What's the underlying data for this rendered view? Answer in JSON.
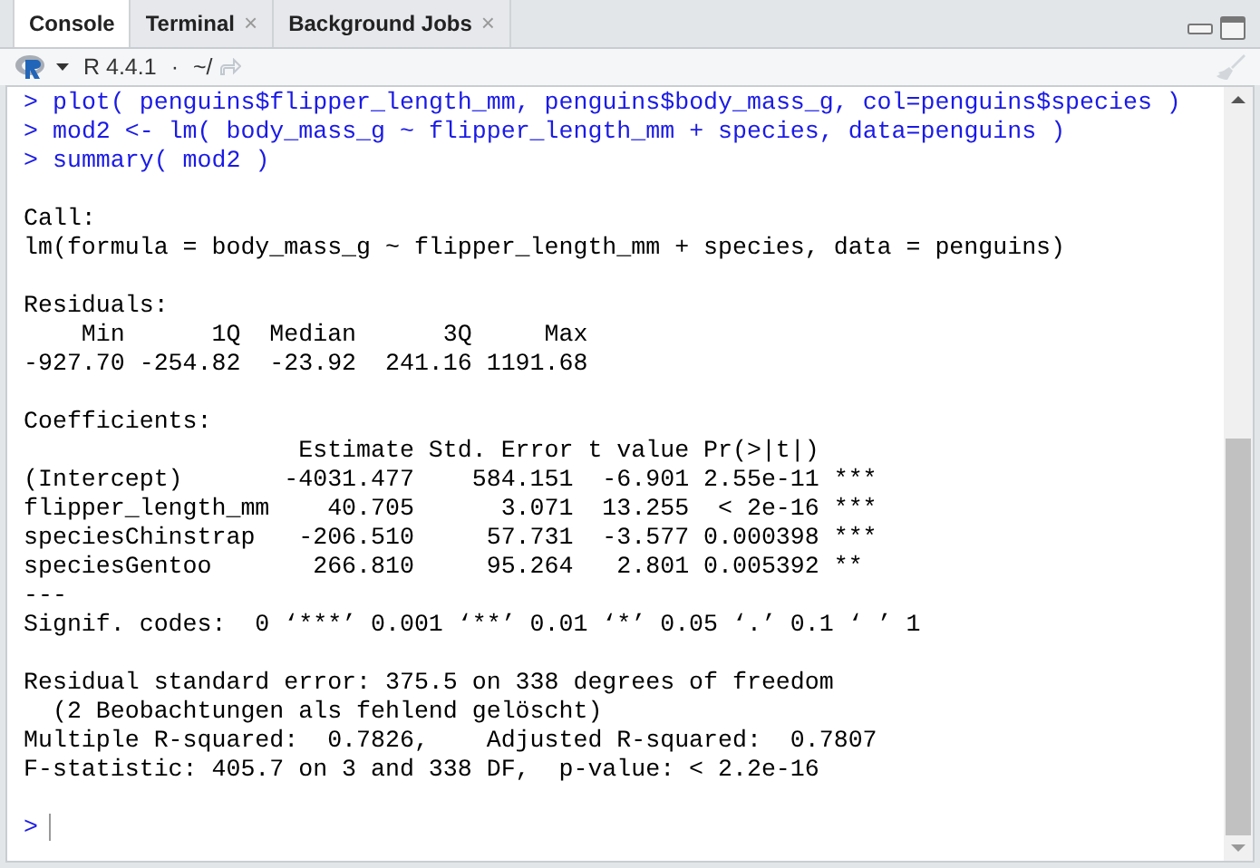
{
  "tabs": [
    {
      "label": "Console",
      "selected": true
    },
    {
      "label": "Terminal",
      "selected": false,
      "close": "×"
    },
    {
      "label": "Background Jobs",
      "selected": false,
      "close": "×"
    }
  ],
  "toolbar": {
    "version": "R 4.4.1",
    "separator": "·",
    "path": "~/"
  },
  "console": {
    "lines": [
      {
        "kind": "command",
        "prompt": ">",
        "text": "plot( penguins$flipper_length_mm, penguins$body_mass_g, col=penguins$species )"
      },
      {
        "kind": "command",
        "prompt": ">",
        "text": "mod2 <- lm( body_mass_g ~ flipper_length_mm + species, data=penguins )"
      },
      {
        "kind": "command",
        "prompt": ">",
        "text": "summary( mod2 )"
      },
      {
        "kind": "blank"
      },
      {
        "kind": "output",
        "text": "Call:"
      },
      {
        "kind": "output",
        "text": "lm(formula = body_mass_g ~ flipper_length_mm + species, data = penguins)"
      },
      {
        "kind": "blank"
      },
      {
        "kind": "output",
        "text": "Residuals:"
      },
      {
        "kind": "output",
        "text": "    Min      1Q  Median      3Q     Max"
      },
      {
        "kind": "output",
        "text": "-927.70 -254.82  -23.92  241.16 1191.68"
      },
      {
        "kind": "blank"
      },
      {
        "kind": "output",
        "text": "Coefficients:"
      },
      {
        "kind": "output",
        "text": "                   Estimate Std. Error t value Pr(>|t|)"
      },
      {
        "kind": "output",
        "text": "(Intercept)       -4031.477    584.151  -6.901 2.55e-11 ***"
      },
      {
        "kind": "output",
        "text": "flipper_length_mm    40.705      3.071  13.255  < 2e-16 ***"
      },
      {
        "kind": "output",
        "text": "speciesChinstrap   -206.510     57.731  -3.577 0.000398 ***"
      },
      {
        "kind": "output",
        "text": "speciesGentoo       266.810     95.264   2.801 0.005392 **"
      },
      {
        "kind": "output",
        "text": "---"
      },
      {
        "kind": "output",
        "text": "Signif. codes:  0 ‘***’ 0.001 ‘**’ 0.01 ‘*’ 0.05 ‘.’ 0.1 ‘ ’ 1"
      },
      {
        "kind": "blank"
      },
      {
        "kind": "output",
        "text": "Residual standard error: 375.5 on 338 degrees of freedom"
      },
      {
        "kind": "output",
        "text": "  (2 Beobachtungen als fehlend gelöscht)"
      },
      {
        "kind": "output",
        "text": "Multiple R-squared:  0.7826,    Adjusted R-squared:  0.7807"
      },
      {
        "kind": "output",
        "text": "F-statistic: 405.7 on 3 and 338 DF,  p-value: < 2.2e-16"
      },
      {
        "kind": "blank"
      },
      {
        "kind": "prompt",
        "prompt": ">"
      }
    ]
  }
}
